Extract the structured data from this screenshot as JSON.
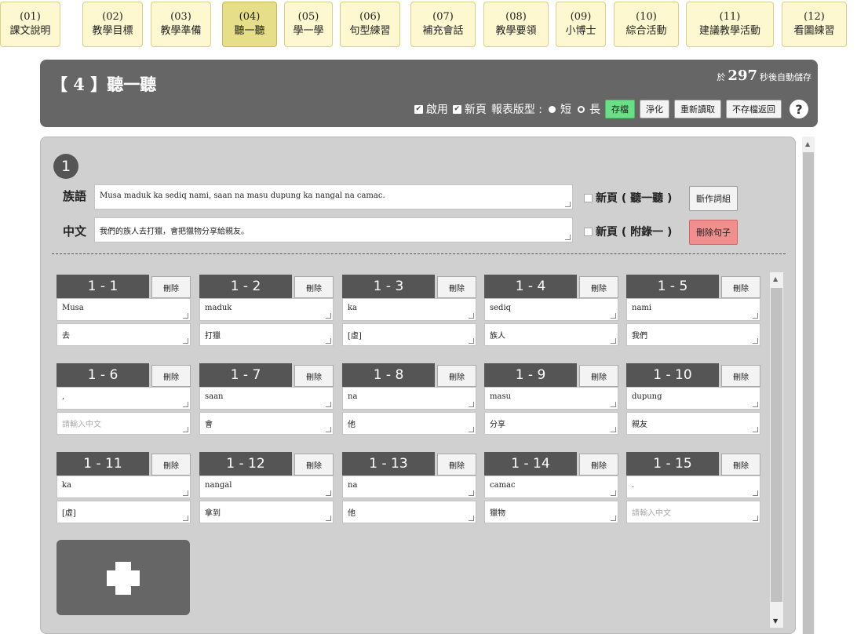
{
  "tabs": [
    {
      "num": "(01)",
      "label": "課文說明"
    },
    {
      "num": "(02)",
      "label": "教學目標"
    },
    {
      "num": "(03)",
      "label": "教學準備"
    },
    {
      "num": "(04)",
      "label": "聽一聽",
      "active": true
    },
    {
      "num": "(05)",
      "label": "學一學"
    },
    {
      "num": "(06)",
      "label": "句型練習"
    },
    {
      "num": "(07)",
      "label": "補充會話"
    },
    {
      "num": "(08)",
      "label": "教學要領"
    },
    {
      "num": "(09)",
      "label": "小博士"
    },
    {
      "num": "(10)",
      "label": "綜合活動"
    },
    {
      "num": "(11)",
      "label": "建議教學活動"
    },
    {
      "num": "(12)",
      "label": "看圖練習"
    }
  ],
  "header": {
    "title": "【 4 】聽一聽",
    "autosave_prefix": "於",
    "autosave_seconds": "297",
    "autosave_suffix": "秒後自動儲存",
    "enable_label": "啟用",
    "newpage_label": "新頁",
    "report_label": "報表版型 :",
    "short_label": "短",
    "long_label": "長",
    "btn_save": "存檔",
    "btn_clean": "淨化",
    "btn_reload": "重新讀取",
    "btn_discard": "不存檔返回",
    "help": "?"
  },
  "sentence": {
    "number": "1",
    "lang_label": "族語",
    "lang_value": "Musa maduk ka sediq nami, saan na masu dupung ka nangal na camac.",
    "zh_label": "中文",
    "zh_value": "我們的族人去打獵，會把獵物分享給親友。",
    "newpage_listen": "新頁 ( 聽一聽 )",
    "newpage_appendix": "新頁 ( 附錄一 )",
    "btn_split": "斷作詞組",
    "btn_delete": "刪除句子"
  },
  "delete_label": "刪除",
  "words": [
    {
      "id": "1 - 1",
      "word": "Musa",
      "zh": "去"
    },
    {
      "id": "1 - 2",
      "word": "maduk",
      "zh": "打獵"
    },
    {
      "id": "1 - 3",
      "word": "ka",
      "zh": "[虛]"
    },
    {
      "id": "1 - 4",
      "word": "sediq",
      "zh": "族人"
    },
    {
      "id": "1 - 5",
      "word": "nami",
      "zh": "我們"
    },
    {
      "id": "1 - 6",
      "word": ",",
      "zh": "",
      "zh_placeholder": "請輸入中文"
    },
    {
      "id": "1 - 7",
      "word": "saan",
      "zh": "會"
    },
    {
      "id": "1 - 8",
      "word": "na",
      "zh": "他"
    },
    {
      "id": "1 - 9",
      "word": "masu",
      "zh": "分享"
    },
    {
      "id": "1 - 10",
      "word": "dupung",
      "zh": "親友"
    },
    {
      "id": "1 - 11",
      "word": "ka",
      "zh": "[虛]"
    },
    {
      "id": "1 - 12",
      "word": "nangal",
      "zh": "拿到"
    },
    {
      "id": "1 - 13",
      "word": "na",
      "zh": "他"
    },
    {
      "id": "1 - 14",
      "word": "camac",
      "zh": "獵物"
    },
    {
      "id": "1 - 15",
      "word": ".",
      "zh": "",
      "zh_placeholder": "請輸入中文"
    }
  ],
  "colors": {
    "tab_bg": "#fdf8cf",
    "tab_active_bg": "#e7de8a",
    "header_bg": "#666666",
    "save_green": "#6ae086",
    "delete_red": "#f18e8e"
  }
}
